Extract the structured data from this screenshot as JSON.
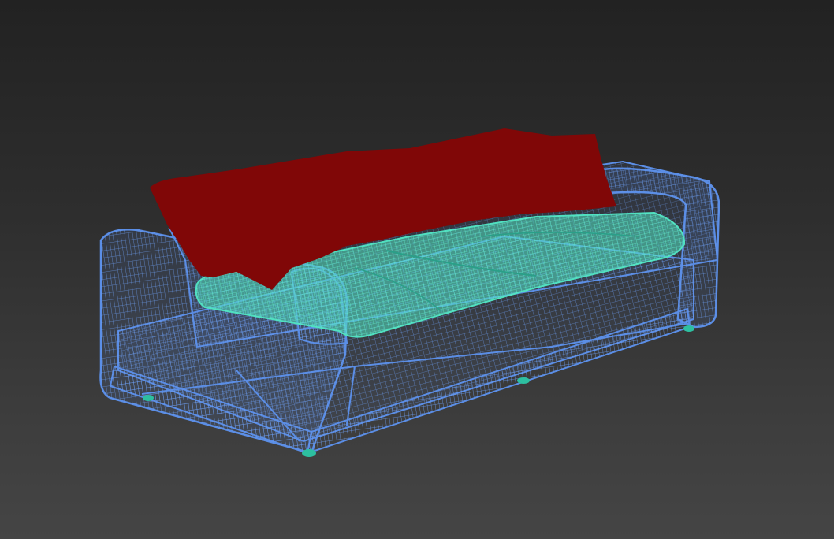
{
  "viewport": {
    "label": "",
    "mode": "wireframe",
    "background_top": "#222222",
    "background_bottom": "#454545"
  },
  "scene": {
    "object": "sofa",
    "parts": [
      {
        "name": "sofa-frame",
        "color": "#5b8ee6",
        "display": "wireframe"
      },
      {
        "name": "seat-cushions",
        "color": "#50e0c0",
        "display": "wireframe"
      },
      {
        "name": "throw-blanket",
        "color": "#800707",
        "display": "solid"
      },
      {
        "name": "sofa-feet",
        "color": "#2dbfa0",
        "display": "solid"
      }
    ]
  }
}
